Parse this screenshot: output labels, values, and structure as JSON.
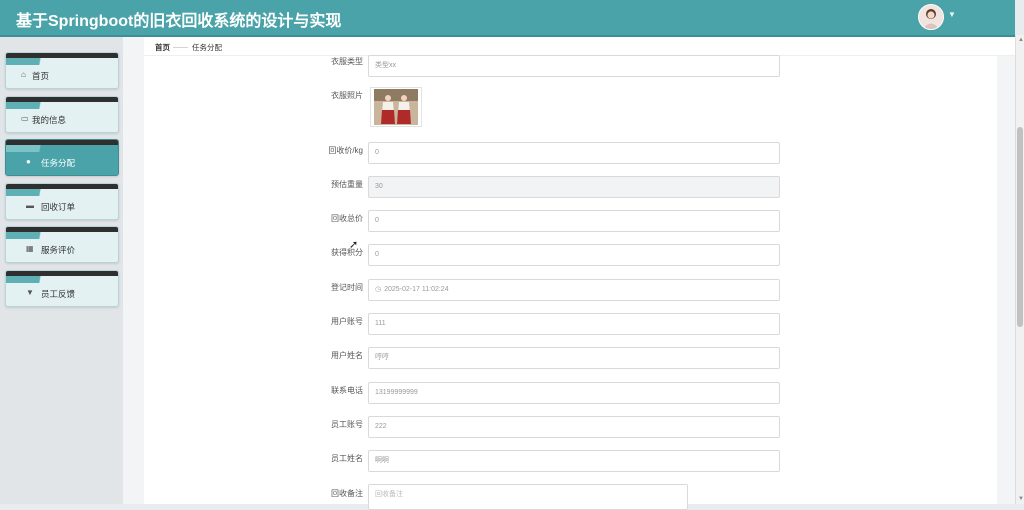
{
  "header": {
    "title": "基于Springboot的旧衣回收系统的设计与实现"
  },
  "sidebar": {
    "items": [
      {
        "label": "首页",
        "icon": "home-icon",
        "active": false
      },
      {
        "label": "我的信息",
        "icon": "profile-card-icon",
        "active": false
      },
      {
        "label": "任务分配",
        "icon": "user-icon",
        "active": true
      },
      {
        "label": "回收订单",
        "icon": "order-icon",
        "active": false
      },
      {
        "label": "服务评价",
        "icon": "grid-icon",
        "active": false
      },
      {
        "label": "员工反馈",
        "icon": "feedback-icon",
        "active": false
      }
    ]
  },
  "breadcrumb": {
    "home": "首页",
    "separator": "——",
    "current": "任务分配"
  },
  "form": {
    "clothes_type": {
      "label": "衣服类型",
      "value": "类型xx"
    },
    "clothes_photo": {
      "label": "衣服照片"
    },
    "price_per_kg": {
      "label": "回收价/kg",
      "value": "0"
    },
    "estimated_weight": {
      "label": "预估重量",
      "value": "30"
    },
    "total_price": {
      "label": "回收总价",
      "value": "0"
    },
    "points": {
      "label": "获得积分",
      "value": "0"
    },
    "register_time": {
      "label": "登记时间",
      "value": "2025-02-17 11:02:24"
    },
    "user_account": {
      "label": "用户账号",
      "value": "111"
    },
    "user_name": {
      "label": "用户姓名",
      "value": "哼哼"
    },
    "phone": {
      "label": "联系电话",
      "value": "13199999999"
    },
    "staff_account": {
      "label": "员工账号",
      "value": "222"
    },
    "staff_name": {
      "label": "员工姓名",
      "value": "啊啊"
    },
    "remark": {
      "label": "回收备注",
      "placeholder": "回收备注"
    }
  },
  "colors": {
    "header": "#4aa3a8",
    "sidebar_active": "#4aa3a8"
  }
}
